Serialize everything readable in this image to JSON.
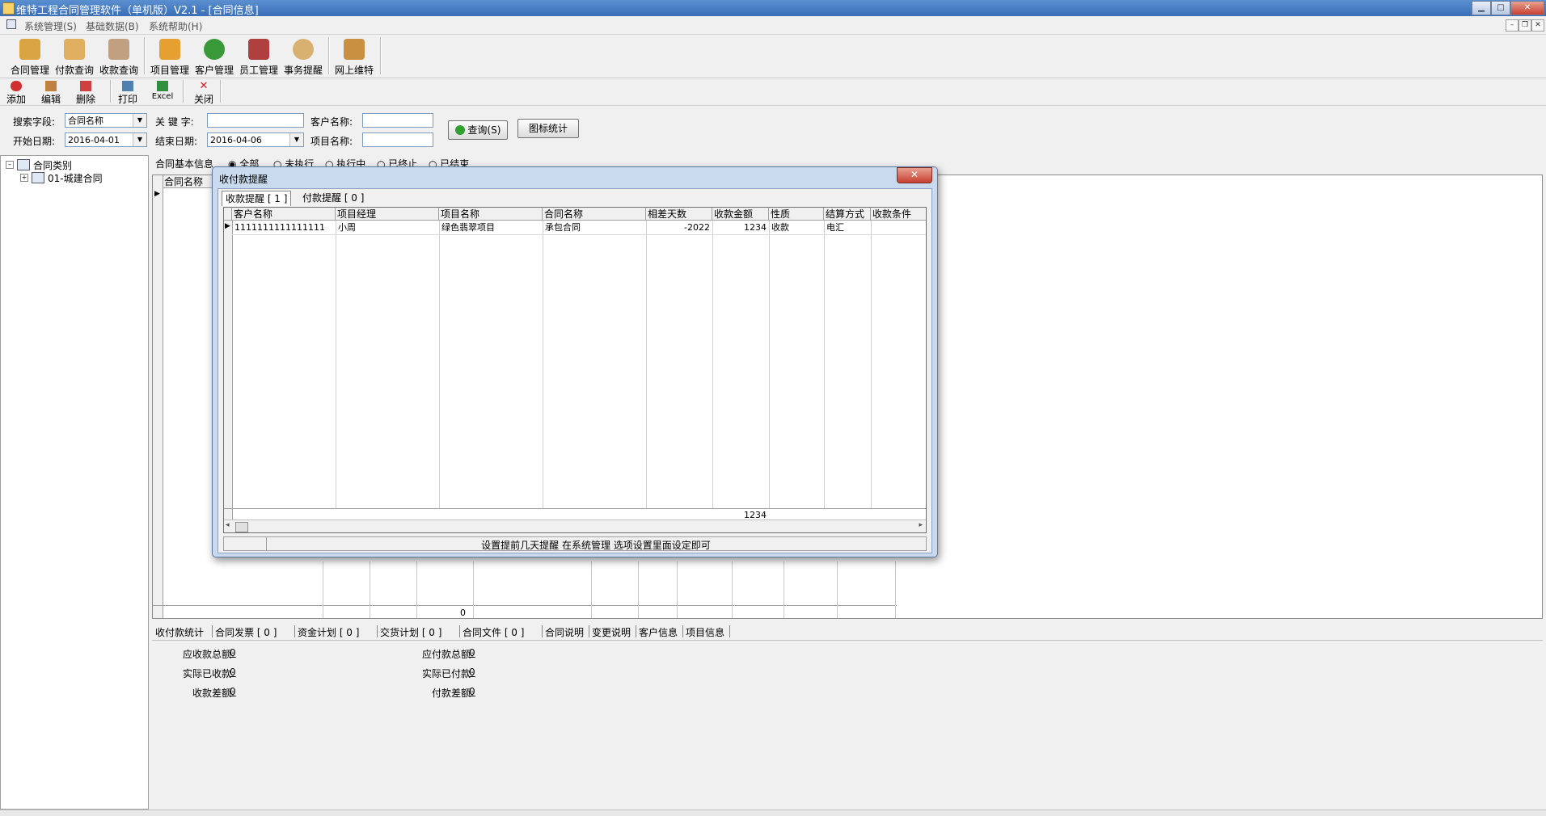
{
  "window": {
    "title": "维特工程合同管理软件（单机版）V2.1 - [合同信息]",
    "controls": [
      "minimize",
      "maximize",
      "close"
    ]
  },
  "menu": [
    "系统管理(S)",
    "基础数据(B)",
    "系统帮助(H)"
  ],
  "big_toolbar": [
    {
      "label": "合同管理",
      "icon": "contract-icon",
      "color": "#d9a441"
    },
    {
      "label": "付款查询",
      "icon": "pen-icon",
      "color": "#e0b060"
    },
    {
      "label": "收款查询",
      "icon": "receipt-icon",
      "color": "#c0a080"
    },
    {
      "label": "项目管理",
      "icon": "project-icon",
      "color": "#e6a030"
    },
    {
      "label": "客户管理",
      "icon": "customer-icon",
      "color": "#3a9a3a"
    },
    {
      "label": "员工管理",
      "icon": "staff-icon",
      "color": "#b04040"
    },
    {
      "label": "事务提醒",
      "icon": "reminder-icon",
      "color": "#d8b070"
    },
    {
      "label": "网上维特",
      "icon": "web-icon",
      "color": "#c89040"
    }
  ],
  "small_toolbar": [
    {
      "label": "添加",
      "icon": "add-icon",
      "color": "#d03030"
    },
    {
      "label": "编辑",
      "icon": "edit-icon",
      "color": "#c08040"
    },
    {
      "label": "删除",
      "icon": "delete-icon",
      "color": "#d04040"
    },
    {
      "label": "打印",
      "icon": "print-icon",
      "color": "#5080b0"
    },
    {
      "label": "Excel",
      "icon": "excel-icon",
      "color": "#2f8f3f"
    },
    {
      "label": "关闭",
      "icon": "close-x-icon",
      "color": "#d02020"
    }
  ],
  "search": {
    "field_label": "搜索字段:",
    "field_value": "合同名称",
    "keyword_label": "关 键 字:",
    "keyword_value": "",
    "customer_label": "客户名称:",
    "customer_value": "",
    "start_label": "开始日期:",
    "start_value": "2016-04-01",
    "end_label": "结束日期:",
    "end_value": "2016-04-06",
    "project_label": "项目名称:",
    "project_value": "",
    "query_button": "查询(S)",
    "chart_button": "图标统计"
  },
  "tree": {
    "root": "合同类别",
    "child": "01-城建合同"
  },
  "filter": {
    "label": "合同基本信息",
    "options": [
      "全部",
      "未执行",
      "执行中",
      "已终止",
      "已结束"
    ],
    "selected": "全部"
  },
  "main_grid": {
    "first_header": "合同名称",
    "footer_value": "0"
  },
  "dialog": {
    "title": "收付款提醒",
    "close_label": "✕",
    "tabs": [
      "收款提醒 [ 1 ]",
      "付款提醒 [ 0 ]"
    ],
    "columns": [
      "客户名称",
      "项目经理",
      "项目名称",
      "合同名称",
      "相差天数",
      "收款金额",
      "性质",
      "结算方式",
      "收款条件"
    ],
    "rows": [
      [
        "1111111111111111",
        "小周",
        "绿色翡翠项目",
        "承包合同",
        "-2022",
        "1234",
        "收款",
        "电汇",
        ""
      ]
    ],
    "total": "1234",
    "status_message": "设置提前几天提醒 在系统管理 选项设置里面设定即可"
  },
  "bottom_tabs": [
    "收付款统计",
    "合同发票 [ 0 ]",
    "资金计划 [ 0 ]",
    "交货计划 [ 0 ]",
    "合同文件 [ 0 ]",
    "合同说明",
    "变更说明",
    "客户信息",
    "项目信息"
  ],
  "stats": {
    "receivable_total_label": "应收款总额:",
    "receivable_total": "0",
    "received_label": "实际已收款:",
    "received": "0",
    "receive_diff_label": "收款差额:",
    "receive_diff": "0",
    "payable_total_label": "应付款总额:",
    "payable_total": "0",
    "paid_label": "实际已付款:",
    "paid": "0",
    "pay_diff_label": "付款差额:",
    "pay_diff": "0"
  }
}
